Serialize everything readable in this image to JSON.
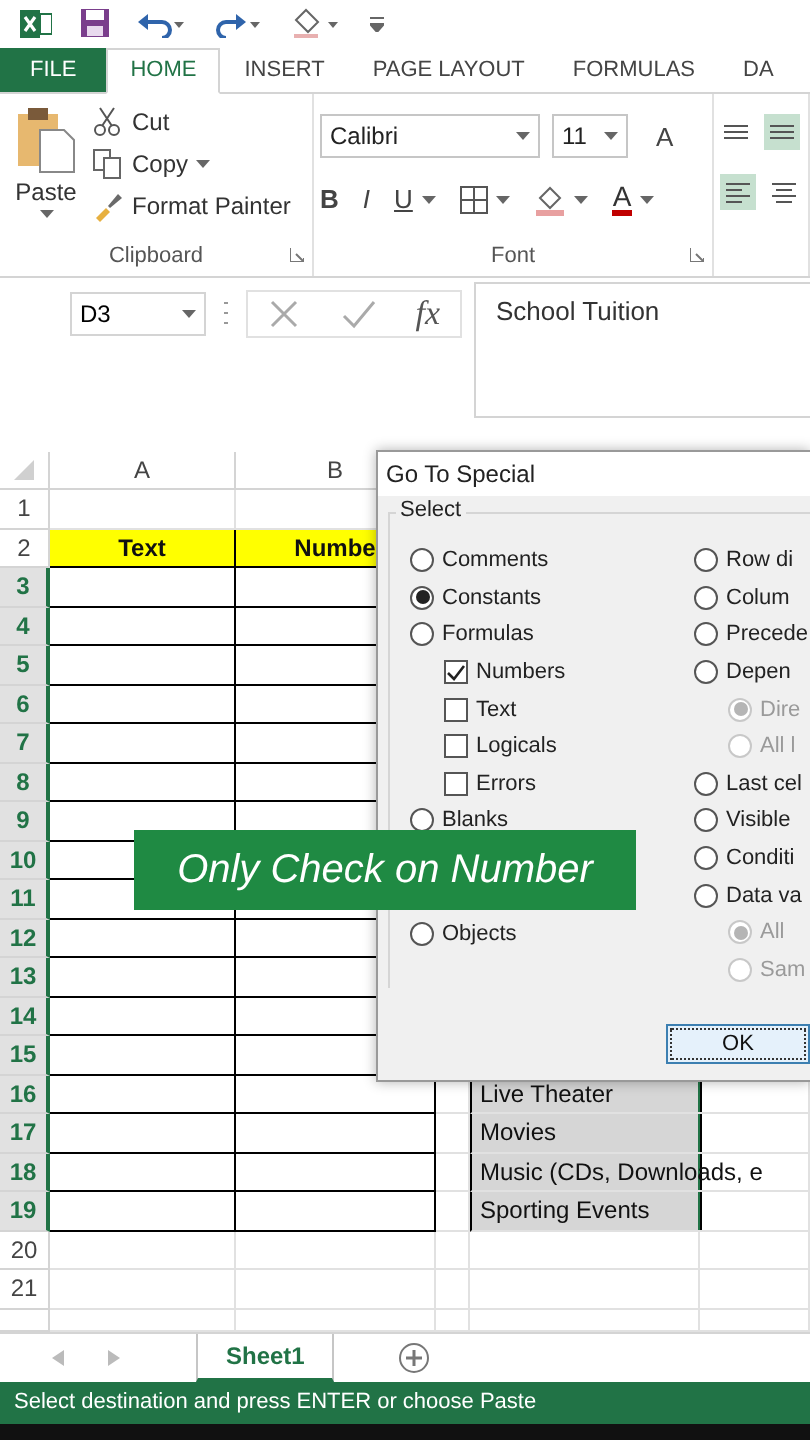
{
  "ribbon_tabs": [
    {
      "label": "FILE",
      "kind": "file",
      "selected": false
    },
    {
      "label": "HOME",
      "kind": "tab",
      "selected": true
    },
    {
      "label": "INSERT",
      "kind": "tab",
      "selected": false
    },
    {
      "label": "PAGE LAYOUT",
      "kind": "tab",
      "selected": false
    },
    {
      "label": "FORMULAS",
      "kind": "tab",
      "selected": false
    },
    {
      "label": "DA",
      "kind": "tab",
      "selected": false
    }
  ],
  "clipboard": {
    "paste": "Paste",
    "cut": "Cut",
    "copy": "Copy",
    "format_painter": "Format Painter",
    "label": "Clipboard"
  },
  "font": {
    "name": "Calibri",
    "size": "11",
    "grow": "A",
    "bold": "B",
    "italic": "I",
    "underline": "U",
    "font_color": "A",
    "label": "Font"
  },
  "formula_bar": {
    "name_box": "D3",
    "fx": "fx",
    "value": "School Tuition"
  },
  "sheet": {
    "columns": [
      {
        "label": "A"
      },
      {
        "label": "B"
      }
    ],
    "rows": [
      {
        "label": "1",
        "kind": "blank",
        "selected": false
      },
      {
        "label": "2",
        "kind": "header",
        "selected": false,
        "a": "Text",
        "b": "Numbe"
      },
      {
        "label": "3",
        "kind": "table",
        "selected": true
      },
      {
        "label": "4",
        "kind": "table",
        "selected": true
      },
      {
        "label": "5",
        "kind": "table",
        "selected": true
      },
      {
        "label": "6",
        "kind": "table",
        "selected": true
      },
      {
        "label": "7",
        "kind": "table",
        "selected": true
      },
      {
        "label": "8",
        "kind": "table",
        "selected": true
      },
      {
        "label": "9",
        "kind": "table",
        "selected": true
      },
      {
        "label": "10",
        "kind": "table",
        "selected": true
      },
      {
        "label": "11",
        "kind": "table",
        "selected": true
      },
      {
        "label": "12",
        "kind": "table",
        "selected": true
      },
      {
        "label": "13",
        "kind": "table",
        "selected": true
      },
      {
        "label": "14",
        "kind": "table",
        "selected": true
      },
      {
        "label": "15",
        "kind": "table",
        "selected": true
      },
      {
        "label": "16",
        "kind": "table",
        "selected": true,
        "d": "Live Theater"
      },
      {
        "label": "17",
        "kind": "table",
        "selected": true,
        "d": "Movies"
      },
      {
        "label": "18",
        "kind": "table",
        "selected": true,
        "d": "Music (CDs, Downloads, e"
      },
      {
        "label": "19",
        "kind": "table",
        "selected": true,
        "d": "Sporting Events"
      },
      {
        "label": "20",
        "kind": "blank",
        "selected": false
      },
      {
        "label": "21",
        "kind": "blank",
        "selected": false
      }
    ]
  },
  "dialog": {
    "title": "Go To Special",
    "group": "Select",
    "left": [
      {
        "kind": "radio",
        "label": "Comments",
        "selected": false
      },
      {
        "kind": "radio",
        "label": "Constants",
        "selected": true
      },
      {
        "kind": "radio",
        "label": "Formulas",
        "selected": false
      },
      {
        "kind": "check",
        "label": "Numbers",
        "checked": true
      },
      {
        "kind": "check",
        "label": "Text",
        "checked": false
      },
      {
        "kind": "check",
        "label": "Logicals",
        "checked": false
      },
      {
        "kind": "check",
        "label": "Errors",
        "checked": false
      },
      {
        "kind": "radio",
        "label": "Blanks",
        "selected": false
      },
      {
        "kind": "radio",
        "label": "Objects",
        "selected": false
      }
    ],
    "right": [
      {
        "kind": "radio",
        "label": "Row di",
        "selected": false
      },
      {
        "kind": "radio",
        "label": "Colum",
        "selected": false
      },
      {
        "kind": "radio",
        "label": "Precede",
        "selected": false
      },
      {
        "kind": "radio",
        "label": "Depen",
        "selected": false
      },
      {
        "kind": "sub",
        "label": "Dire",
        "selected": true,
        "disabled": true
      },
      {
        "kind": "sub",
        "label": "All l",
        "selected": false,
        "disabled": true
      },
      {
        "kind": "radio",
        "label": "Last cel",
        "selected": false
      },
      {
        "kind": "radio",
        "label": "Visible",
        "selected": false
      },
      {
        "kind": "radio",
        "label": "Conditi",
        "selected": false
      },
      {
        "kind": "radio",
        "label": "Data va",
        "selected": false
      },
      {
        "kind": "sub",
        "label": "All",
        "selected": true,
        "disabled": true
      },
      {
        "kind": "sub",
        "label": "Sam",
        "selected": false,
        "disabled": true
      }
    ],
    "ok": "OK"
  },
  "caption": "Only Check on Number",
  "sheet_tabs": [
    {
      "label": "Sheet1",
      "selected": true
    }
  ],
  "status_bar": "Select destination and press ENTER or choose Paste"
}
